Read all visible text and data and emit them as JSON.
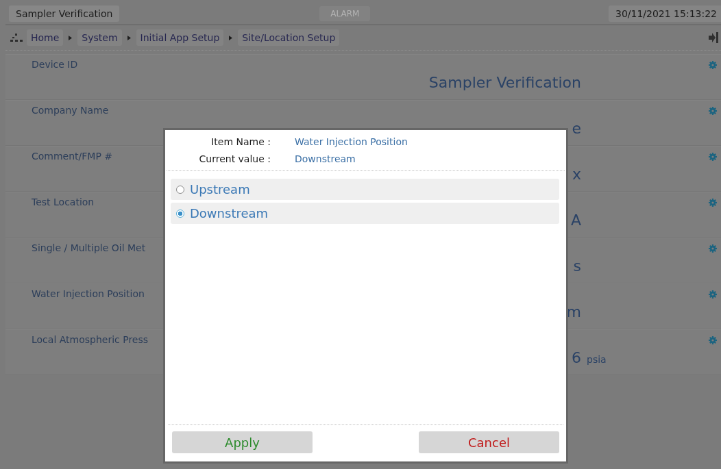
{
  "header": {
    "title": "Sampler Verification",
    "alarm": {
      "label": "ALARM",
      "active": false
    },
    "datetime": "30/11/2021 15:13:22"
  },
  "breadcrumb": [
    "Home",
    "System",
    "Initial App Setup",
    "Site/Location Setup"
  ],
  "settings": [
    {
      "label": "Device ID",
      "value": "Sampler Verification"
    },
    {
      "label": "Company Name",
      "value": "e"
    },
    {
      "label": "Comment/FMP #",
      "value": "x"
    },
    {
      "label": "Test Location",
      "value": "A"
    },
    {
      "label": "Single / Multiple Oil Met",
      "value": "s"
    },
    {
      "label": "Water Injection Position",
      "value": "m"
    },
    {
      "label": "Local Atmospheric Press",
      "value": "6",
      "unit": "psia"
    }
  ],
  "dialog": {
    "item_name_label": "Item Name :",
    "item_name": "Water Injection Position",
    "current_value_label": "Current value :",
    "current_value": "Downstream",
    "options": [
      {
        "label": "Upstream",
        "selected": false
      },
      {
        "label": "Downstream",
        "selected": true
      }
    ],
    "buttons": [
      {
        "label": "Apply",
        "kind": "confirm"
      },
      {
        "label": "Cancel",
        "kind": "cancel"
      }
    ]
  }
}
